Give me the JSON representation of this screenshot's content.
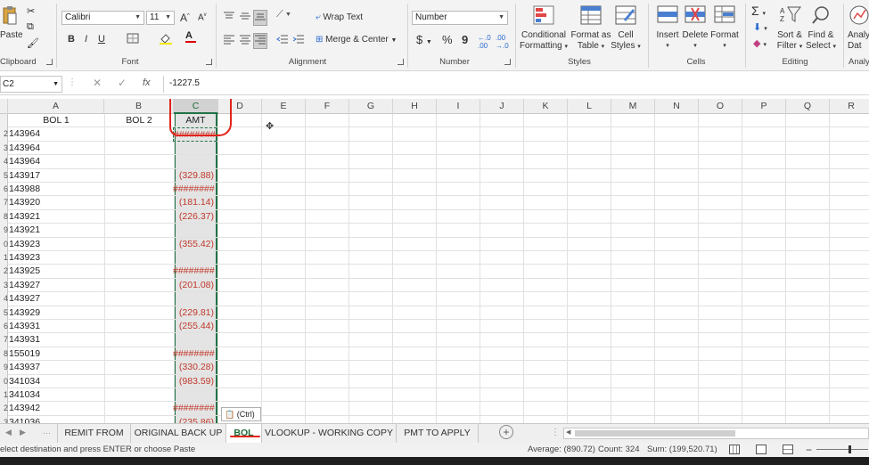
{
  "ribbon": {
    "clipboard": {
      "paste": "Paste",
      "label": "Clipboard"
    },
    "font": {
      "name": "Calibri",
      "size": "11",
      "grow": "A",
      "shrink": "A",
      "bold": "B",
      "italic": "I",
      "underline": "U",
      "font_color": "A",
      "label": "Font"
    },
    "alignment": {
      "wrap_text": "Wrap Text",
      "merge_center": "Merge & Center",
      "label": "Alignment"
    },
    "number": {
      "format": "Number",
      "currency": "$",
      "percent": "%",
      "comma": "9",
      "label": "Number"
    },
    "styles": {
      "conditional": [
        "Conditional",
        "Formatting"
      ],
      "format_table": [
        "Format as",
        "Table"
      ],
      "cell_styles": [
        "Cell",
        "Styles"
      ],
      "label": "Styles"
    },
    "cells": {
      "insert": "Insert",
      "delete": "Delete",
      "format": "Format",
      "label": "Cells"
    },
    "editing": {
      "sum": "Σ",
      "sort_filter": [
        "Sort &",
        "Filter"
      ],
      "find_select": [
        "Find &",
        "Select"
      ],
      "label": "Editing"
    },
    "analyze": {
      "label_short": "Analy",
      "label2": "Dat",
      "group": "Analy"
    }
  },
  "formula_bar": {
    "name_box": "C2",
    "fx": "fx",
    "value": "-1227.5"
  },
  "columns": [
    "A",
    "B",
    "C",
    "D",
    "E",
    "F",
    "G",
    "H",
    "I",
    "J",
    "K",
    "L",
    "M",
    "N",
    "O",
    "P",
    "Q",
    "R"
  ],
  "header_row": {
    "a": "BOL 1",
    "b": "BOL 2",
    "c": "AMT"
  },
  "rows": [
    {
      "num": "2",
      "a": "143964",
      "c": "########"
    },
    {
      "num": "3",
      "a": "143964",
      "c": ""
    },
    {
      "num": "4",
      "a": "143964",
      "c": ""
    },
    {
      "num": "5",
      "a": "143917",
      "c": "(329.88)"
    },
    {
      "num": "6",
      "a": "143988",
      "c": "########"
    },
    {
      "num": "7",
      "a": "143920",
      "c": "(181.14)"
    },
    {
      "num": "8",
      "a": "143921",
      "c": "(226.37)"
    },
    {
      "num": "9",
      "a": "143921",
      "c": ""
    },
    {
      "num": "0",
      "a": "143923",
      "c": "(355.42)"
    },
    {
      "num": "1",
      "a": "143923",
      "c": ""
    },
    {
      "num": "2",
      "a": "143925",
      "c": "########"
    },
    {
      "num": "3",
      "a": "143927",
      "c": "(201.08)"
    },
    {
      "num": "4",
      "a": "143927",
      "c": ""
    },
    {
      "num": "5",
      "a": "143929",
      "c": "(229.81)"
    },
    {
      "num": "6",
      "a": "143931",
      "c": "(255.44)"
    },
    {
      "num": "7",
      "a": "143931",
      "c": ""
    },
    {
      "num": "8",
      "a": "155019",
      "c": "########"
    },
    {
      "num": "9",
      "a": "143937",
      "c": "(330.28)"
    },
    {
      "num": "0",
      "a": "341034",
      "c": "(983.59)"
    },
    {
      "num": "1",
      "a": "341034",
      "c": ""
    },
    {
      "num": "2",
      "a": "143942",
      "c": "########"
    },
    {
      "num": "3",
      "a": "341036",
      "c": "(235.86)"
    }
  ],
  "paste_options": "(Ctrl)",
  "tabs": [
    "REMIT FROM",
    "ORIGINAL BACK UP",
    "BOL",
    "VLOOKUP - WORKING COPY",
    "PMT TO APPLY"
  ],
  "add_sheet": "+",
  "status": {
    "message": "elect destination and press ENTER or choose Paste",
    "average": "Average: (890.72)",
    "count": "Count: 324",
    "sum": "Sum: (199,520.71)"
  },
  "colors": {
    "accent_green": "#217346",
    "negative_red": "#c0392b",
    "annotation_red": "#e2231a"
  }
}
